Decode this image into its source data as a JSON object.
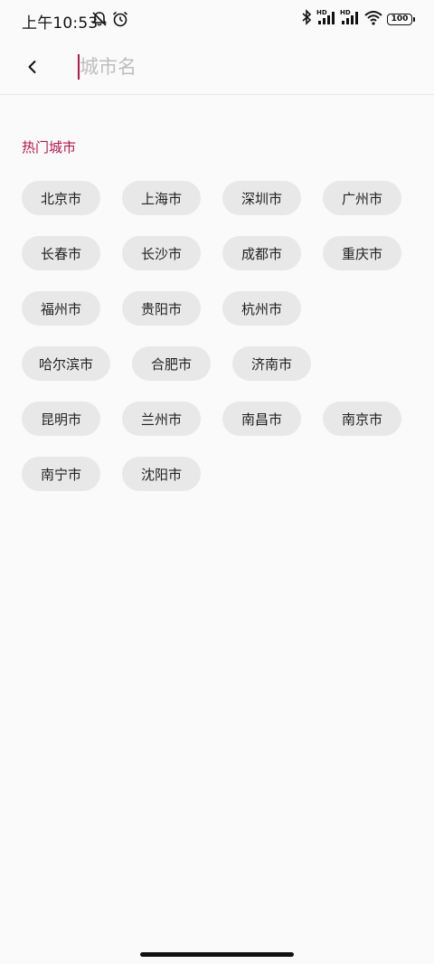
{
  "status_bar": {
    "time": "上午10:53",
    "battery": "100"
  },
  "search": {
    "placeholder": "城市名",
    "value": ""
  },
  "hot_cities": {
    "title": "热门城市",
    "rows": [
      [
        "北京市",
        "上海市",
        "深圳市",
        "广州市"
      ],
      [
        "长春市",
        "长沙市",
        "成都市",
        "重庆市"
      ],
      [
        "福州市",
        "贵阳市",
        "杭州市"
      ],
      [
        "哈尔滨市",
        "合肥市",
        "济南市"
      ],
      [
        "昆明市",
        "兰州市",
        "南昌市",
        "南京市"
      ],
      [
        "南宁市",
        "沈阳市"
      ]
    ]
  },
  "colors": {
    "accent": "#b5164b",
    "chip_bg": "#e8e8e8",
    "background": "#fafafa"
  }
}
